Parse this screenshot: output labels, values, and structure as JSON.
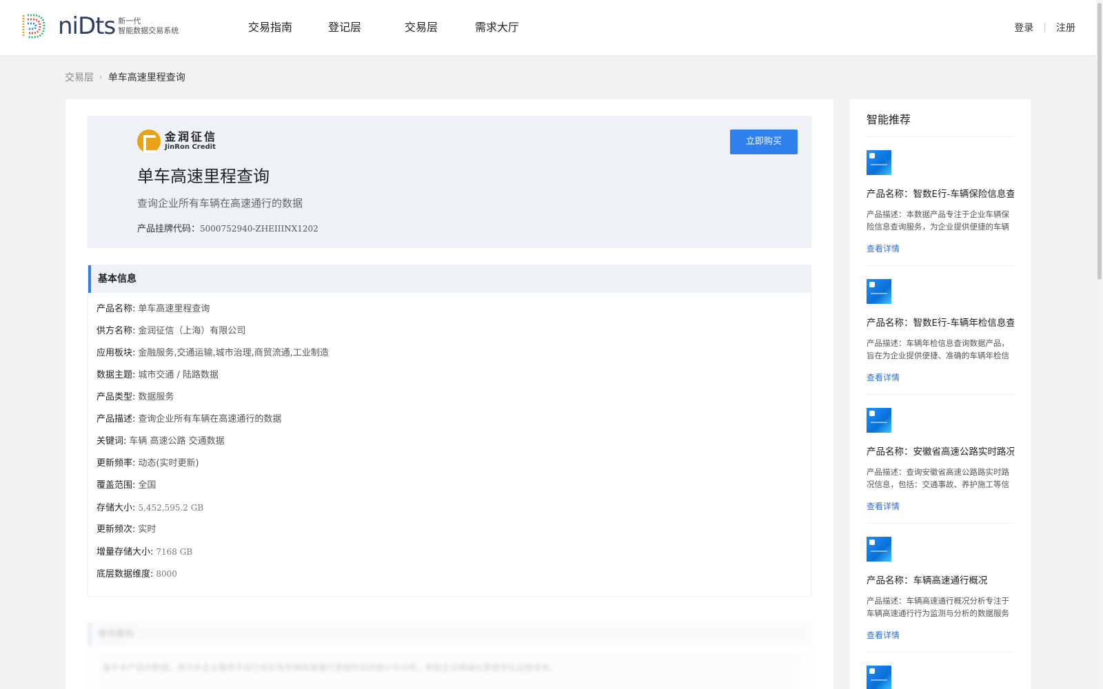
{
  "header": {
    "logo_text": "niDts",
    "logo_sub_1": "新一代",
    "logo_sub_2": "智能数据交易系统",
    "nav": [
      "交易指南",
      "登记层",
      "交易层",
      "需求大厅"
    ],
    "login": "登录",
    "register": "注册",
    "divider": "|"
  },
  "breadcrumb": {
    "parent": "交易层",
    "separator": "›",
    "current": "单车高速里程查询"
  },
  "hero": {
    "brand_cn": "金润征信",
    "brand_en": "JinRon Credit",
    "title": "单车高速里程查询",
    "description": "查询企业所有车辆在高速通行的数据",
    "code_label": "产品挂牌代码：",
    "code_value": "5000752940-ZHEIIINX1202",
    "buy_button": "立即购买"
  },
  "basic_info": {
    "heading": "基本信息",
    "rows": [
      {
        "label": "产品名称:",
        "value": "单车高速里程查询"
      },
      {
        "label": "供方名称:",
        "value": "金润征信（上海）有限公司"
      },
      {
        "label": "应用板块:",
        "value": "金融服务,交通运输,城市治理,商贸流通,工业制造"
      },
      {
        "label": "数据主题:",
        "value": "城市交通 / 陆路数据"
      },
      {
        "label": "产品类型:",
        "value": "数据服务"
      },
      {
        "label": "产品描述:",
        "value": "查询企业所有车辆在高速通行的数据"
      },
      {
        "label": "关键词:",
        "value": "车辆 高速公路 交通数据"
      },
      {
        "label": "更新频率:",
        "value": "动态(实时更新)"
      },
      {
        "label": "覆盖范围:",
        "value": "全国"
      },
      {
        "label": "存储大小:",
        "value": "5,452,595.2 GB"
      },
      {
        "label": "更新频次:",
        "value": "实时"
      },
      {
        "label": "增量存储大小:",
        "value": "7168 GB"
      },
      {
        "label": "底层数据维度:",
        "value": "8000"
      }
    ]
  },
  "blurred_section": {
    "heading": "使用案例",
    "body": "基于本产品的数据，某汽车企业服务平台已经实现车辆高速通行里程的实时统计与分析，帮助企业精细化管理车队运营成本。"
  },
  "sidebar": {
    "title": "智能推荐",
    "items": [
      {
        "name": "产品名称：智数E行-车辆保险信息查询",
        "desc": "产品描述：本数据产品专注于企业车辆保险信息查询服务，为企业提供便捷的车辆保险信息",
        "link": "查看详情"
      },
      {
        "name": "产品名称：智数E行-车辆年检信息查询",
        "desc": "产品描述：车辆年检信息查询数据产品，旨在为企业提供便捷、准确的车辆年检信息",
        "link": "查看详情"
      },
      {
        "name": "产品名称：安徽省高速公路实时路况",
        "desc": "产品描述：查询安徽省高速公路路实时路况信息，包括：交通事故、养护施工等信息",
        "link": "查看详情"
      },
      {
        "name": "产品名称：车辆高速通行概况",
        "desc": "产品描述：车辆高速通行概况分析专注于车辆高速通行行为监测与分析的数据服务",
        "link": "查看详情"
      }
    ]
  },
  "colors": {
    "accent": "#2f80ed",
    "brand_gold": "#e8a317",
    "logo_navy": "#2d3e63"
  }
}
